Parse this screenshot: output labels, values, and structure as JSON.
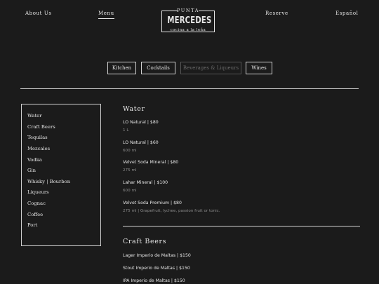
{
  "nav": {
    "about": "About Us",
    "menu": "Menu",
    "reserve": "Reserve",
    "language": "Español"
  },
  "logo": {
    "top": "PUNTA",
    "main": "MERCEDES",
    "sub": "cocina a la leña"
  },
  "tabs": [
    "Kitchen",
    "Cocktails",
    "Beverages & Liqueurs",
    "Wines"
  ],
  "active_tab": "Beverages & Liqueurs",
  "sidebar": {
    "items": [
      "Water",
      "Craft Beers",
      "Tequilas",
      "Mezcales",
      "Vodka",
      "Gin",
      "Whisky | Bourbon",
      "Liqueurs",
      "Cognac",
      "Coffee",
      "Port"
    ]
  },
  "sections": {
    "water": {
      "title": "Water",
      "items": [
        {
          "name": "LO Natural | $80",
          "desc": "1 L"
        },
        {
          "name": "LO Natural | $60",
          "desc": "600 ml"
        },
        {
          "name": "Velvet Soda Mineral | $80",
          "desc": "275 ml"
        },
        {
          "name": "Lahar Mineral | $100",
          "desc": "600 ml"
        },
        {
          "name": "Velvet Soda Premium | $80",
          "desc": "275 ml | Grapefruit, lychee, passion fruit or tonic."
        }
      ]
    },
    "beers": {
      "title": "Craft Beers",
      "items": [
        {
          "name": "Lager Imperio de Maltas | $150"
        },
        {
          "name": "Stout Imperio de Maltas | $150"
        },
        {
          "name": "IPA Imperio de Maltas | $150"
        }
      ]
    }
  }
}
